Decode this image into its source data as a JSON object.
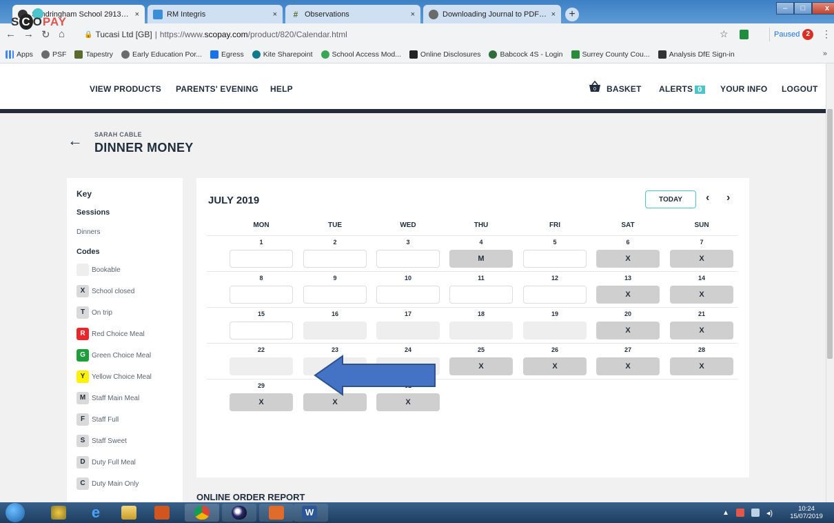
{
  "browser": {
    "tabs": [
      {
        "title": "Sandringham School 2913 Intern",
        "favicon_color": "#333333",
        "active": true
      },
      {
        "title": "RM Integris",
        "favicon_color": "#3a8ed6",
        "active": false
      },
      {
        "title": "Observations",
        "favicon_color": "#5b6b2f",
        "favicon_glyph": "#",
        "active": false
      },
      {
        "title": "Downloading Journal to PDF - Ta",
        "favicon_color": "#6b6b6b",
        "active": false
      }
    ],
    "close_glyph": "×",
    "new_tab_glyph": "+",
    "window_controls": {
      "minimize": "–",
      "maximize": "□",
      "close": "x"
    },
    "url_org": "Tucasi Ltd [GB]",
    "url_sep": "|",
    "url_prefix": "https://www.",
    "url_domain": "scopay.com",
    "url_path": "/product/820/Calendar.html",
    "profile_status": "Paused",
    "profile_badge": "2",
    "more_glyph": "⋮",
    "star_glyph": "☆",
    "bookmarks": [
      {
        "label": "Apps",
        "color": "#4285f4"
      },
      {
        "label": "PSF",
        "color": "#6b6b6b"
      },
      {
        "label": "Tapestry",
        "color": "#5b6b2f"
      },
      {
        "label": "Early Education Por...",
        "color": "#6b6b6b"
      },
      {
        "label": "Egress",
        "color": "#1a73e8"
      },
      {
        "label": "Kite Sharepoint",
        "color": "#0f7b8c"
      },
      {
        "label": "School Access Mod...",
        "color": "#3aa757"
      },
      {
        "label": "Online Disclosures",
        "color": "#222222"
      },
      {
        "label": "Babcock 4S - Login",
        "color": "#2f6e3a"
      },
      {
        "label": "Surrey County Cou...",
        "color": "#2a8c3a"
      },
      {
        "label": "Analysis DfE Sign-in",
        "color": "#333333"
      }
    ],
    "bookmarks_more": "»"
  },
  "site": {
    "logo": {
      "s": "S",
      "c": "C",
      "o": "O",
      "pay": "PAY"
    },
    "nav": {
      "view_products": "VIEW PRODUCTS",
      "parents_evening": "PARENTS' EVENING",
      "help": "HELP",
      "basket": "BASKET",
      "basket_count": "0",
      "alerts": "ALERTS",
      "alerts_count": "0",
      "your_info": "YOUR INFO",
      "logout": "LOGOUT"
    },
    "accent": "#4dc4c9",
    "header_rule_color": "#252c39"
  },
  "page": {
    "back_glyph": "←",
    "learner_name": "SARAH CABLE",
    "title": "DINNER MONEY"
  },
  "key": {
    "heading": "Key",
    "sessions_heading": "Sessions",
    "sessions": [
      "Dinners"
    ],
    "codes_heading": "Codes",
    "codes": [
      {
        "code": "",
        "label": "Bookable",
        "bg": "#eeeeee",
        "fg": "#1f2d3d"
      },
      {
        "code": "X",
        "label": "School closed",
        "bg": "#d9d9d9",
        "fg": "#1f2d3d"
      },
      {
        "code": "T",
        "label": "On trip",
        "bg": "#d9d9d9",
        "fg": "#1f2d3d"
      },
      {
        "code": "R",
        "label": "Red Choice Meal",
        "bg": "#e8262b",
        "fg": "#ffffff"
      },
      {
        "code": "G",
        "label": "Green Choice Meal",
        "bg": "#1e9e3a",
        "fg": "#ffffff"
      },
      {
        "code": "Y",
        "label": "Yellow Choice Meal",
        "bg": "#fff200",
        "fg": "#1f2d3d"
      },
      {
        "code": "M",
        "label": "Staff Main Meal",
        "bg": "#d9d9d9",
        "fg": "#1f2d3d"
      },
      {
        "code": "F",
        "label": "Staff Full",
        "bg": "#d9d9d9",
        "fg": "#1f2d3d"
      },
      {
        "code": "S",
        "label": "Staff Sweet",
        "bg": "#d9d9d9",
        "fg": "#1f2d3d"
      },
      {
        "code": "D",
        "label": "Duty Full Meal",
        "bg": "#d9d9d9",
        "fg": "#1f2d3d"
      },
      {
        "code": "C",
        "label": "Duty Main Only",
        "bg": "#d9d9d9",
        "fg": "#1f2d3d"
      }
    ]
  },
  "calendar": {
    "month_label": "JULY 2019",
    "today_label": "TODAY",
    "prev_glyph": "‹",
    "next_glyph": "›",
    "weekdays": [
      "MON",
      "TUE",
      "WED",
      "THU",
      "FRI",
      "SAT",
      "SUN"
    ],
    "weeks": [
      [
        {
          "day": "1",
          "state": "bookable",
          "code": ""
        },
        {
          "day": "2",
          "state": "bookable",
          "code": ""
        },
        {
          "day": "3",
          "state": "bookable",
          "code": ""
        },
        {
          "day": "4",
          "state": "closed",
          "code": "M"
        },
        {
          "day": "5",
          "state": "bookable",
          "code": ""
        },
        {
          "day": "6",
          "state": "closed",
          "code": "X"
        },
        {
          "day": "7",
          "state": "closed",
          "code": "X"
        }
      ],
      [
        {
          "day": "8",
          "state": "bookable",
          "code": ""
        },
        {
          "day": "9",
          "state": "bookable",
          "code": ""
        },
        {
          "day": "10",
          "state": "bookable",
          "code": ""
        },
        {
          "day": "11",
          "state": "bookable",
          "code": ""
        },
        {
          "day": "12",
          "state": "bookable",
          "code": ""
        },
        {
          "day": "13",
          "state": "closed",
          "code": "X"
        },
        {
          "day": "14",
          "state": "closed",
          "code": "X"
        }
      ],
      [
        {
          "day": "15",
          "state": "bookable",
          "code": ""
        },
        {
          "day": "16",
          "state": "pending",
          "code": ""
        },
        {
          "day": "17",
          "state": "pending",
          "code": ""
        },
        {
          "day": "18",
          "state": "pending",
          "code": ""
        },
        {
          "day": "19",
          "state": "pending",
          "code": ""
        },
        {
          "day": "20",
          "state": "closed",
          "code": "X"
        },
        {
          "day": "21",
          "state": "closed",
          "code": "X"
        }
      ],
      [
        {
          "day": "22",
          "state": "pending",
          "code": ""
        },
        {
          "day": "23",
          "state": "pending",
          "code": ""
        },
        {
          "day": "24",
          "state": "pending",
          "code": ""
        },
        {
          "day": "25",
          "state": "closed",
          "code": "X"
        },
        {
          "day": "26",
          "state": "closed",
          "code": "X"
        },
        {
          "day": "27",
          "state": "closed",
          "code": "X"
        },
        {
          "day": "28",
          "state": "closed",
          "code": "X"
        }
      ],
      [
        {
          "day": "29",
          "state": "closed",
          "code": "X"
        },
        {
          "day": "30",
          "state": "closed",
          "code": "X"
        },
        {
          "day": "31",
          "state": "closed",
          "code": "X"
        }
      ]
    ]
  },
  "report_heading": "ONLINE ORDER REPORT",
  "annotation_arrow_color": "#4472c4",
  "taskbar": {
    "time": "10:24",
    "date": "15/07/2019",
    "tray_glyph": "▲"
  }
}
